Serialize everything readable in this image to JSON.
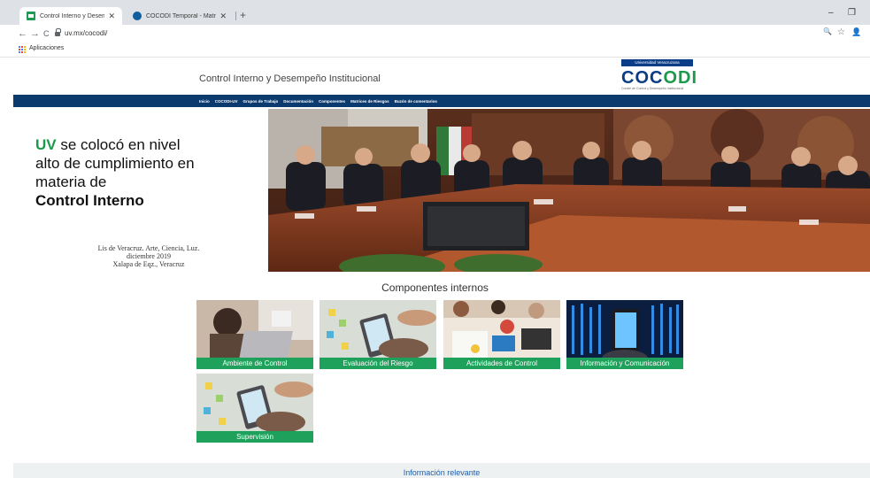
{
  "browser": {
    "tabs": [
      {
        "title": "Control Interno y Desempeño In...",
        "close": "✕"
      },
      {
        "title": "COCODI Temporal - MatrizRiesg...",
        "close": "✕"
      }
    ],
    "new_tab": "+",
    "window_min": "–",
    "window_restore": "❐",
    "back": "←",
    "forward": "→",
    "reload": "C",
    "url": "uv.mx/cocodi/",
    "zoom_icon": "🔍",
    "star_icon": "☆",
    "account_icon": "👤",
    "bookmark_apps": "Aplicaciones"
  },
  "site": {
    "title": "Control Interno y Desempeño Institucional",
    "logo_badge": "Universidad Veracruzana",
    "logo_part1": "COC",
    "logo_part2": "ODI",
    "logo_sub": "Comité de Control y Desempeño Institucional",
    "nav": [
      "Inicio",
      "COCODI-UV",
      "Grupos de Trabajo",
      "Documentación",
      "Componentes",
      "Matrices de Riesgos",
      "Buzón de comentarios"
    ]
  },
  "hero": {
    "line1_uv": "UV",
    "line1_rest": " se colocó en nivel",
    "line2": "alto de cumplimiento en",
    "line3": "materia de",
    "line4": "Control Interno",
    "foot1": "Lis de Veracruz. Arte, Ciencia, Luz.",
    "foot2": "diciembre 2019",
    "foot3": "Xalapa de Eqz., Veracruz"
  },
  "components": {
    "heading": "Componentes internos",
    "cards": [
      {
        "label": "Ambiente de Control"
      },
      {
        "label": "Evaluación del Riesgo"
      },
      {
        "label": "Actividades de Control"
      },
      {
        "label": "Información y Comunicación"
      },
      {
        "label": "Supervisión"
      }
    ]
  },
  "footer": {
    "label": "Información relevante"
  },
  "colors": {
    "nav_bg": "#0b3a6e",
    "card_label": "#1ea15b",
    "accent_green": "#1a9a4a",
    "logo_blue": "#0a3d87"
  }
}
